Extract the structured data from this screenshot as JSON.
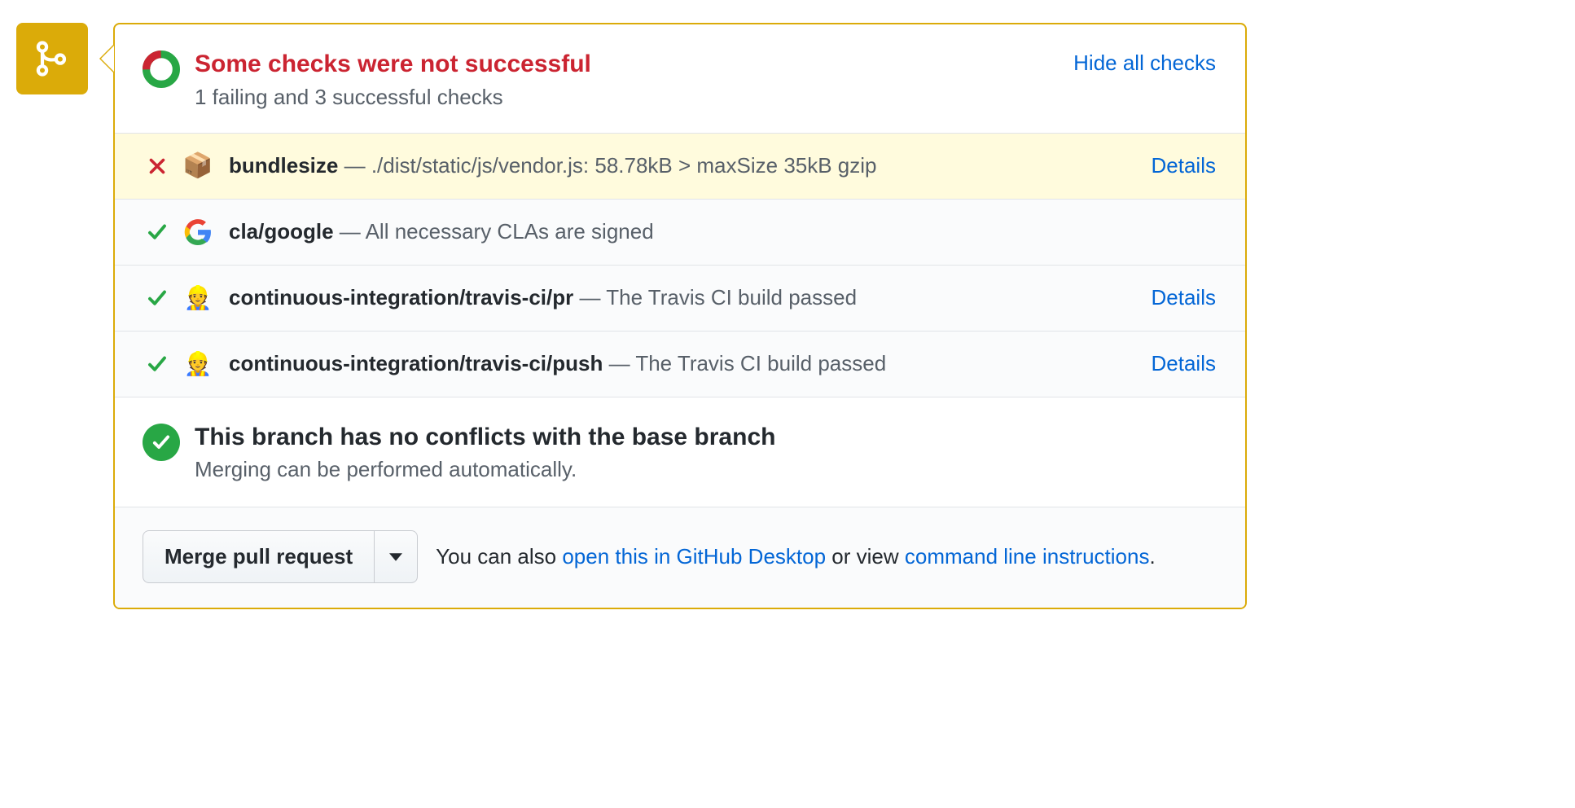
{
  "header": {
    "title": "Some checks were not successful",
    "subtitle": "1 failing and 3 successful checks",
    "hide_link": "Hide all checks"
  },
  "checks": [
    {
      "status": "fail",
      "icon": "package",
      "name": "bundlesize",
      "sep": " — ",
      "desc": "./dist/static/js/vendor.js: 58.78kB > maxSize 35kB gzip",
      "details": "Details"
    },
    {
      "status": "pass",
      "icon": "google",
      "name": "cla/google",
      "sep": " — ",
      "desc": "All necessary CLAs are signed",
      "details": ""
    },
    {
      "status": "pass",
      "icon": "travis",
      "name": "continuous-integration/travis-ci/pr",
      "sep": " — ",
      "desc": "The Travis CI build passed",
      "details": "Details"
    },
    {
      "status": "pass",
      "icon": "travis",
      "name": "continuous-integration/travis-ci/push",
      "sep": " — ",
      "desc": "The Travis CI build passed",
      "details": "Details"
    }
  ],
  "conflict": {
    "title": "This branch has no conflicts with the base branch",
    "subtitle": "Merging can be performed automatically."
  },
  "merge": {
    "button": "Merge pull request",
    "prefix": "You can also ",
    "desktop_link": "open this in GitHub Desktop",
    "middle": " or view ",
    "cli_link": "command line instructions",
    "suffix": "."
  }
}
